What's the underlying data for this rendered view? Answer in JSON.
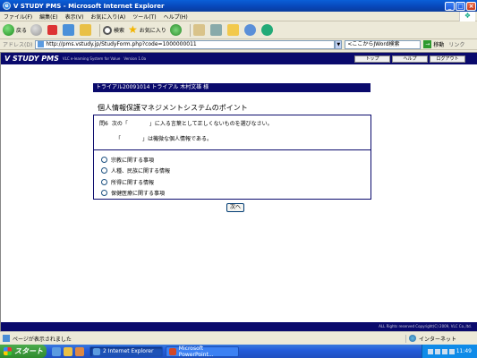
{
  "window": {
    "title": "V STUDY PMS - Microsoft Internet Explorer"
  },
  "menu": [
    "ファイル(F)",
    "編集(E)",
    "表示(V)",
    "お気に入り(A)",
    "ツール(T)",
    "ヘルプ(H)"
  ],
  "toolbar": {
    "back_label": "戻る",
    "search_label": "検索",
    "favorites_label": "お気に入り"
  },
  "address": {
    "label": "アドレス(D)",
    "url": "http://pms.vstudy.jp/StudyForm.php?code=1000000011",
    "keyword_placeholder": "<ここからJWord検索",
    "go_label": "移動",
    "links_label": "リンク"
  },
  "app": {
    "brand": "V STUDY PMS",
    "tagline": "VLC e-learning System for Value",
    "version": "Version 1.0a",
    "nav": {
      "top": "トップ",
      "help": "ヘルプ",
      "logout": "ログアウト"
    },
    "trial_info": "トライアル20091014 トライアル 木村文雄 様",
    "section_title": "個人情報保護マネジメントシステムのポイント",
    "question": {
      "number": "問6",
      "text": "次の「　　　　」に入る言葉として正しくないものを選びなさい。",
      "sentence": "「　　　　」は機微な個人情報である。"
    },
    "options": [
      "宗教に関する事項",
      "人種、民族に関する情報",
      "所得に関する情報",
      "保健医療に関する事項"
    ],
    "next_label": "次へ",
    "footer": "ALL Rights reserved Copyright(C) 2009, VLC Co.,ltd."
  },
  "status": {
    "message": "ページが表示されました",
    "zone": "インターネット"
  },
  "taskbar": {
    "start": "スタート",
    "tasks": [
      "2 Internet Explorer",
      "Microsoft PowerPoint..."
    ],
    "clock": "11:49"
  },
  "colors": {
    "app_navy": "#0a0a6c",
    "xp_blue": "#245ddb"
  }
}
